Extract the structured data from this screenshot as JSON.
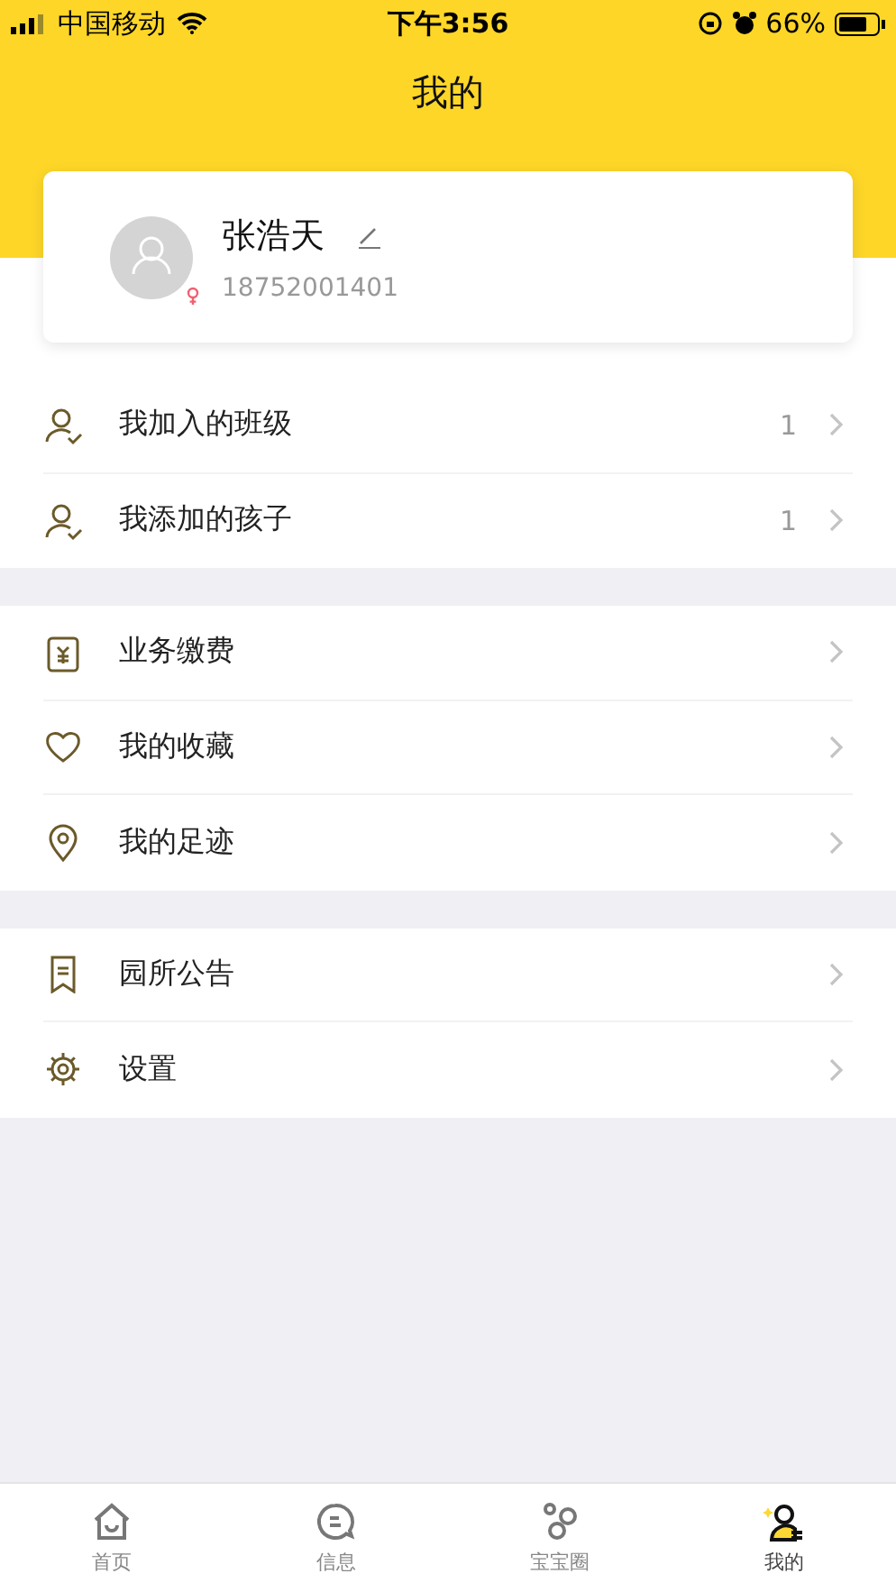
{
  "status_bar": {
    "carrier": "中国移动",
    "time": "下午3:56",
    "battery": "66%"
  },
  "title": "我的",
  "profile": {
    "name": "张浩天",
    "phone": "18752001401"
  },
  "sections": [
    {
      "items": [
        {
          "kind": "member",
          "label": "我加入的班级",
          "count": "1"
        },
        {
          "kind": "member",
          "label": "我添加的孩子",
          "count": "1"
        }
      ]
    },
    {
      "items": [
        {
          "kind": "bill",
          "label": "业务缴费"
        },
        {
          "kind": "heart",
          "label": "我的收藏"
        },
        {
          "kind": "pin",
          "label": "我的足迹"
        }
      ]
    },
    {
      "items": [
        {
          "kind": "bookmark",
          "label": "园所公告"
        },
        {
          "kind": "gear",
          "label": "设置"
        }
      ]
    }
  ],
  "tabs": [
    {
      "kind": "home",
      "label": "首页",
      "selected": false
    },
    {
      "kind": "chat",
      "label": "信息",
      "selected": false
    },
    {
      "kind": "rings",
      "label": "宝宝圈",
      "selected": false
    },
    {
      "kind": "me",
      "label": "我的",
      "selected": true
    }
  ]
}
